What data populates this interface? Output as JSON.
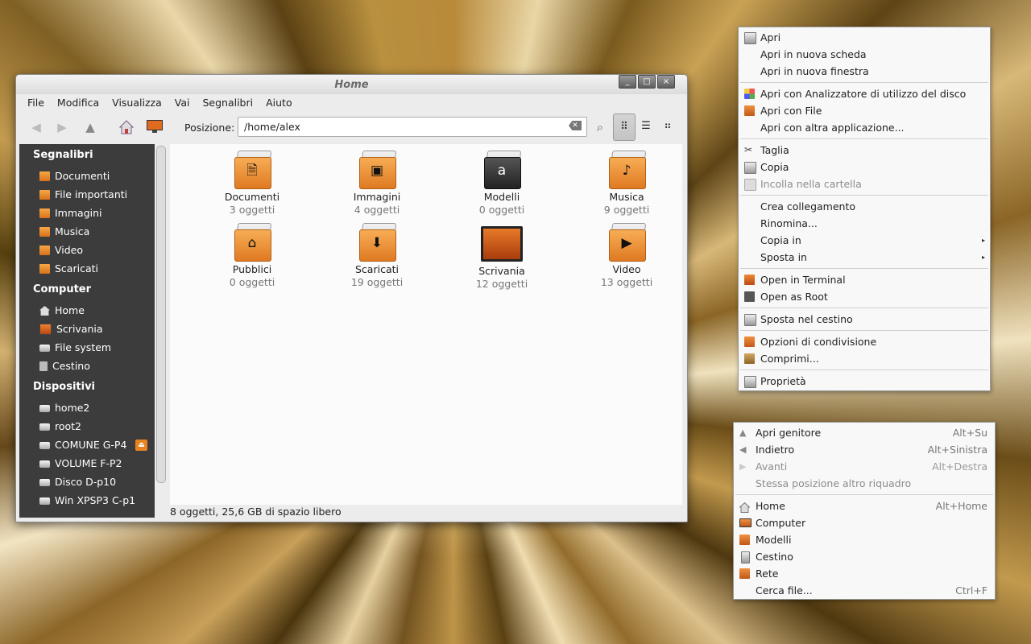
{
  "window": {
    "title": "Home",
    "buttons": [
      "_",
      "□",
      "×"
    ],
    "menubar": [
      "File",
      "Modifica",
      "Visualizza",
      "Vai",
      "Segnalibri",
      "Aiuto"
    ],
    "toolbar": {
      "position_label": "Posizione:",
      "path": "/home/alex"
    },
    "sidebar": {
      "sections": [
        {
          "title": "Segnalibri",
          "items": [
            "Documenti",
            "File importanti",
            "Immagini",
            "Musica",
            "Video",
            "Scaricati"
          ]
        },
        {
          "title": "Computer",
          "items": [
            "Home",
            "Scrivania",
            "File system",
            "Cestino"
          ]
        },
        {
          "title": "Dispositivi",
          "items": [
            "home2",
            "root2",
            "COMUNE G-P4",
            "VOLUME F-P2",
            "Disco D-p10",
            "Win XPSP3 C-p1"
          ]
        }
      ]
    },
    "files": [
      {
        "name": "Documenti",
        "count": "3 oggetti",
        "icon": "document-icon"
      },
      {
        "name": "Immagini",
        "count": "4 oggetti",
        "icon": "picture-icon"
      },
      {
        "name": "Modelli",
        "count": "0 oggetti",
        "icon": "template-icon"
      },
      {
        "name": "Musica",
        "count": "9 oggetti",
        "icon": "music-note-icon"
      },
      {
        "name": "Pubblici",
        "count": "0 oggetti",
        "icon": "house-icon"
      },
      {
        "name": "Scaricati",
        "count": "19 oggetti",
        "icon": "download-arrow-icon"
      },
      {
        "name": "Scrivania",
        "count": "12 oggetti",
        "icon": "desktop-icon"
      },
      {
        "name": "Video",
        "count": "13 oggetti",
        "icon": "film-icon"
      }
    ],
    "status": "8 oggetti, 25,6 GB di spazio libero"
  },
  "context_menu": {
    "items": [
      {
        "label": "Apri",
        "icon": "open-icon"
      },
      {
        "label": "Apri in nuova scheda"
      },
      {
        "label": "Apri in nuova finestra"
      },
      {
        "label": "Apri con Analizzatore di utilizzo del disco",
        "icon": "disk-usage-icon"
      },
      {
        "label": "Apri con File",
        "icon": "file-manager-icon"
      },
      {
        "label": "Apri con altra applicazione..."
      },
      {
        "label": "Taglia",
        "icon": "scissors-icon"
      },
      {
        "label": "Copia",
        "icon": "copy-icon"
      },
      {
        "label": "Incolla nella cartella",
        "icon": "paste-icon",
        "disabled": true
      },
      {
        "label": "Crea collegamento"
      },
      {
        "label": "Rinomina..."
      },
      {
        "label": "Copia in",
        "submenu": true
      },
      {
        "label": "Sposta in",
        "submenu": true
      },
      {
        "label": "Open in Terminal",
        "icon": "terminal-icon"
      },
      {
        "label": "Open as Root",
        "icon": "root-icon"
      },
      {
        "label": "Sposta nel cestino",
        "icon": "trash-icon"
      },
      {
        "label": "Opzioni di condivisione",
        "icon": "share-icon"
      },
      {
        "label": "Comprimi...",
        "icon": "archive-icon"
      },
      {
        "label": "Proprietà",
        "icon": "properties-icon"
      }
    ],
    "submenu_arrow": "▸"
  },
  "go_menu": {
    "items": [
      {
        "label": "Apri genitore",
        "shortcut": "Alt+Su",
        "icon": "up-arrow-icon"
      },
      {
        "label": "Indietro",
        "shortcut": "Alt+Sinistra",
        "icon": "back-arrow-icon"
      },
      {
        "label": "Avanti",
        "shortcut": "Alt+Destra",
        "icon": "forward-arrow-icon",
        "disabled": true
      },
      {
        "label": "Stessa posizione altro riquadro",
        "disabled": true
      },
      {
        "label": "Home",
        "shortcut": "Alt+Home",
        "icon": "home-icon"
      },
      {
        "label": "Computer",
        "icon": "computer-icon"
      },
      {
        "label": "Modelli",
        "icon": "templates-icon"
      },
      {
        "label": "Cestino",
        "icon": "trash-icon"
      },
      {
        "label": "Rete",
        "icon": "network-icon"
      },
      {
        "label": "Cerca file...",
        "shortcut": "Ctrl+F"
      }
    ]
  }
}
